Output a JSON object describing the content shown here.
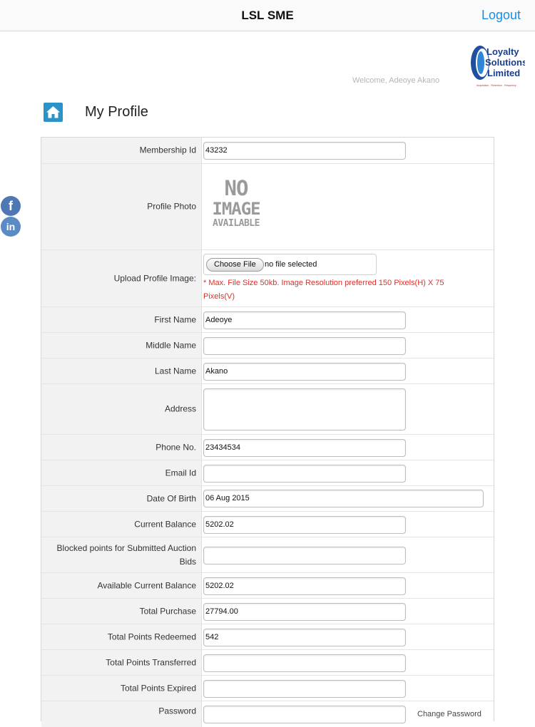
{
  "navbar": {
    "title": "LSL SME",
    "logout_label": "Logout"
  },
  "logo": {
    "line1": "Loyalty",
    "line2": "Solutions",
    "line3": "Limited",
    "tagline": "Acquisition . Retention . Frequency"
  },
  "welcome": "Welcome, Adeoye Akano",
  "page_title": "My Profile",
  "social": {
    "facebook_glyph": "f",
    "linkedin_glyph": "in"
  },
  "form": {
    "membership_id": {
      "label": "Membership Id",
      "value": "43232"
    },
    "profile_photo": {
      "label": "Profile Photo",
      "placeholder_line1": "NO",
      "placeholder_line2": "IMAGE",
      "placeholder_line3": "AVAILABLE"
    },
    "upload": {
      "label": "Upload Profile Image:",
      "button": "Choose File",
      "status": "no file selected",
      "note": "* Max. File Size 50kb. Image Resolution preferred 150 Pixels(H) X 75 Pixels(V)"
    },
    "first_name": {
      "label": "First Name",
      "value": "Adeoye"
    },
    "middle_name": {
      "label": "Middle Name",
      "value": ""
    },
    "last_name": {
      "label": "Last Name",
      "value": "Akano"
    },
    "address": {
      "label": "Address",
      "value": ""
    },
    "phone": {
      "label": "Phone No.",
      "value": "23434534"
    },
    "email": {
      "label": "Email Id",
      "value": ""
    },
    "dob": {
      "label": "Date Of Birth",
      "value": "06 Aug 2015"
    },
    "current_balance": {
      "label": "Current Balance",
      "value": "5202.02"
    },
    "blocked_points": {
      "label": "Blocked points for Submitted Auction Bids",
      "value": ""
    },
    "available_balance": {
      "label": "Available Current Balance",
      "value": "5202.02"
    },
    "total_purchase": {
      "label": "Total Purchase",
      "value": "27794.00"
    },
    "points_redeemed": {
      "label": "Total Points Redeemed",
      "value": "542"
    },
    "points_transferred": {
      "label": "Total Points Transferred",
      "value": ""
    },
    "points_expired": {
      "label": "Total Points Expired",
      "value": ""
    },
    "password_partial": {
      "label": "Password",
      "side_text": "Change Password"
    }
  },
  "colors": {
    "accent": "#1a8ee0",
    "home_button": "#2b93c7",
    "note_red": "#e0302a",
    "facebook": "#4e78b3"
  }
}
